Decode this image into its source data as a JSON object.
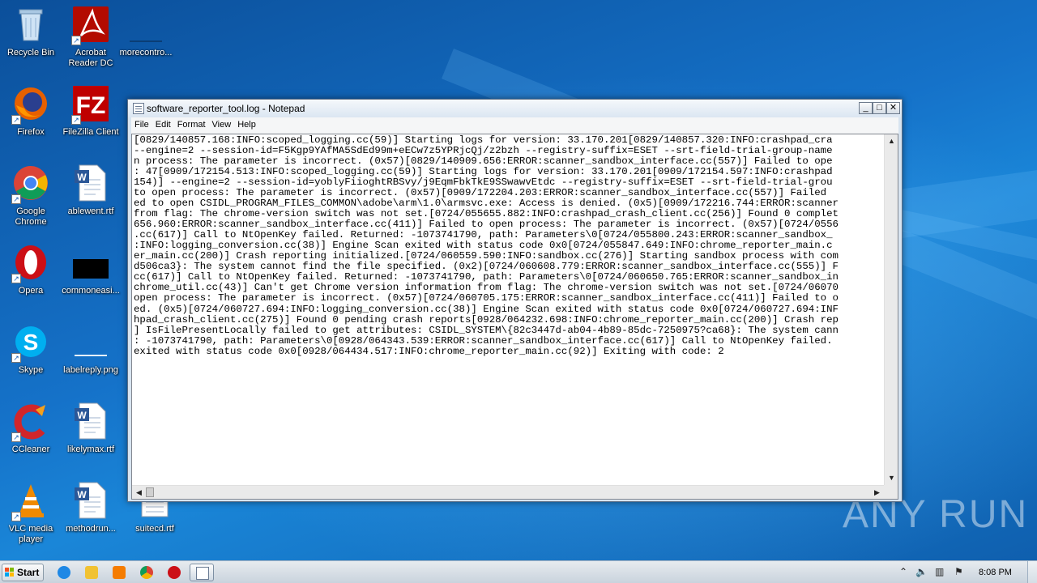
{
  "desktop": {
    "icons": [
      {
        "label": "Recycle Bin",
        "icon": "recycle-bin-icon"
      },
      {
        "label": "Acrobat Reader DC",
        "icon": "acrobat-icon"
      },
      {
        "label": "morecontro...",
        "icon": "file-icon"
      },
      {
        "label": "Firefox",
        "icon": "firefox-icon"
      },
      {
        "label": "FileZilla Client",
        "icon": "filezilla-icon"
      },
      {
        "label": "Google Chrome",
        "icon": "chrome-icon"
      },
      {
        "label": "ablewent.rtf",
        "icon": "word-doc-icon"
      },
      {
        "label": "Opera",
        "icon": "opera-icon"
      },
      {
        "label": "commoneasi...",
        "icon": "file-icon"
      },
      {
        "label": "Skype",
        "icon": "skype-icon"
      },
      {
        "label": "labelreply.png",
        "icon": "image-icon"
      },
      {
        "label": "CCleaner",
        "icon": "ccleaner-icon"
      },
      {
        "label": "likelymax.rtf",
        "icon": "word-doc-icon"
      },
      {
        "label": "VLC media player",
        "icon": "vlc-icon"
      },
      {
        "label": "methodrun...",
        "icon": "word-doc-icon"
      },
      {
        "label": "suitecd.rtf",
        "icon": "file-icon"
      }
    ]
  },
  "notepad": {
    "title": "software_reporter_tool.log - Notepad",
    "menu": [
      "File",
      "Edit",
      "Format",
      "View",
      "Help"
    ],
    "lines": [
      "[0829/140857.168:INFO:scoped_logging.cc(59)] Starting logs for version: 33.170.201[0829/140857.320:INFO:crashpad_cra",
      "--engine=2 --session-id=F5Kgp9YAfMA5SdEd99m+eECw7z5YPRjcQj/z2bzh --registry-suffix=ESET --srt-field-trial-group-name",
      "n process: The parameter is incorrect. (0x57)[0829/140909.656:ERROR:scanner_sandbox_interface.cc(557)] Failed to ope",
      ": 47[0909/172154.513:INFO:scoped_logging.cc(59)] Starting logs for version: 33.170.201[0909/172154.597:INFO:crashpad",
      "154)] --engine=2 --session-id=yoblyFiioghtRBSvy/j9EqmFbkTkE9SSwawvEtdc --registry-suffix=ESET --srt-field-trial-grou",
      "to open process: The parameter is incorrect. (0x57)[0909/172204.203:ERROR:scanner_sandbox_interface.cc(557)] Failed",
      "ed to open CSIDL_PROGRAM_FILES_COMMON\\adobe\\arm\\1.0\\armsvc.exe: Access is denied. (0x5)[0909/172216.744:ERROR:scanner",
      "from flag: The chrome-version switch was not set.[0724/055655.882:INFO:crashpad_crash_client.cc(256)] Found 0 complet",
      "656.960:ERROR:scanner_sandbox_interface.cc(411)] Failed to open process: The parameter is incorrect. (0x57)[0724/0556",
      ".cc(617)] Call to NtOpenKey failed. Returned: -1073741790, path: Parameters\\0[0724/055800.243:ERROR:scanner_sandbox_",
      ":INFO:logging_conversion.cc(38)] Engine Scan exited with status code 0x0[0724/055847.649:INFO:chrome_reporter_main.c",
      "er_main.cc(200)] Crash reporting initialized.[0724/060559.590:INFO:sandbox.cc(276)] Starting sandbox process with com",
      "d506ca3}: The system cannot find the file specified. (0x2)[0724/060608.779:ERROR:scanner_sandbox_interface.cc(555)] F",
      "cc(617)] Call to NtOpenKey failed. Returned: -1073741790, path: Parameters\\0[0724/060650.765:ERROR:scanner_sandbox_in",
      "chrome_util.cc(43)] Can't get Chrome version information from flag: The chrome-version switch was not set.[0724/06070",
      "open process: The parameter is incorrect. (0x57)[0724/060705.175:ERROR:scanner_sandbox_interface.cc(411)] Failed to o",
      "ed. (0x5)[0724/060727.694:INFO:logging_conversion.cc(38)] Engine Scan exited with status code 0x0[0724/060727.694:INF",
      "hpad_crash_client.cc(275)] Found 0 pending crash reports[0928/064232.698:INFO:chrome_reporter_main.cc(200)] Crash rep",
      "] IsFilePresentLocally failed to get attributes: CSIDL_SYSTEM\\{82c3447d-ab04-4b89-85dc-7250975?ca68}: The system cann",
      ": -1073741790, path: Parameters\\0[0928/064343.539:ERROR:scanner_sandbox_interface.cc(617)] Call to NtOpenKey failed.",
      "exited with status code 0x0[0928/064434.517:INFO:chrome_reporter_main.cc(92)] Exiting with code: 2"
    ]
  },
  "taskbar": {
    "start_label": "Start",
    "pinned": [
      "internet-explorer-icon",
      "explorer-icon",
      "media-player-icon",
      "chrome-icon",
      "opera-icon",
      "notepad-icon"
    ],
    "clock": "8:08 PM"
  },
  "watermark": "ANY RUN"
}
